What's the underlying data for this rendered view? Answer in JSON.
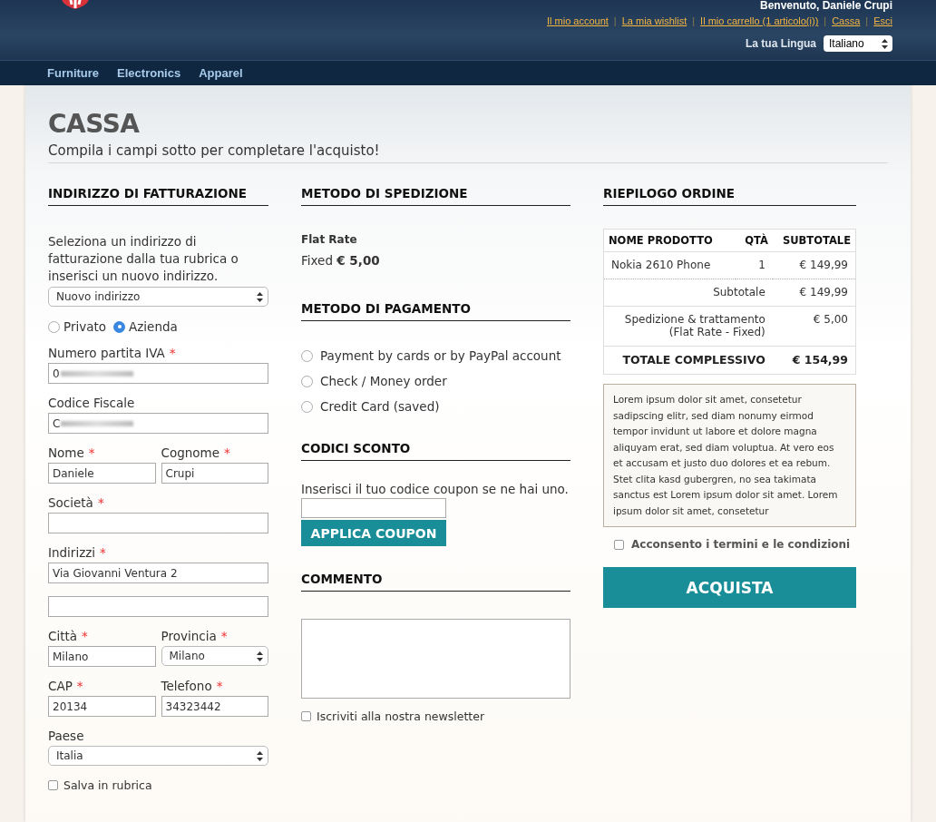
{
  "header": {
    "welcome": "Benvenuto, Daniele Crupi",
    "links": [
      "Il mio account",
      "La mia wishlist",
      "Il mio carrello (1 articolo(i))",
      "Cassa",
      "Esci"
    ],
    "separator": "|",
    "language_label": "La tua Lingua",
    "language": "Italiano"
  },
  "nav": {
    "items": [
      "Furniture",
      "Electronics",
      "Apparel"
    ]
  },
  "page": {
    "title": "CASSA",
    "subtitle": "Compila i campi sotto per completare l'acquisto!"
  },
  "billing": {
    "heading": "INDIRIZZO DI FATTURAZIONE",
    "intro": "Seleziona un indirizzo di fatturazione dalla tua rubrica o inserisci un nuovo indirizzo.",
    "address_select": "Nuovo indirizzo",
    "customer_types": [
      {
        "label": "Privato",
        "selected": false
      },
      {
        "label": "Azienda",
        "selected": true
      }
    ],
    "rows": [
      [
        {
          "kind": "blurred",
          "label": "Numero partita IVA",
          "marker": "*",
          "value": "0"
        }
      ],
      [
        {
          "kind": "blurred",
          "label": "Codice Fiscale",
          "value": "C"
        }
      ],
      [
        {
          "kind": "text",
          "label": "Nome",
          "marker": "*",
          "value": "Daniele"
        },
        {
          "kind": "text",
          "label": "Cognome",
          "marker": "*",
          "value": "Crupi"
        }
      ],
      [
        {
          "kind": "text",
          "label": "Società",
          "marker": "*"
        }
      ],
      [
        {
          "kind": "text",
          "label": "Indirizzi",
          "marker": "*",
          "value": "Via Giovanni Ventura 2"
        }
      ],
      [
        {
          "kind": "text"
        }
      ],
      [
        {
          "kind": "text",
          "label": "Città",
          "marker": "*",
          "value": "Milano"
        },
        {
          "kind": "select",
          "label": "Provincia",
          "marker": "*",
          "value": "Milano"
        }
      ],
      [
        {
          "kind": "text",
          "label": "CAP",
          "marker": "*",
          "value": "20134"
        },
        {
          "kind": "text",
          "label": "Telefono",
          "marker": "*",
          "value": "34323442"
        }
      ],
      [
        {
          "kind": "select",
          "label": "Paese",
          "value": "Italia"
        }
      ]
    ],
    "save": {
      "label": "Salva in rubrica",
      "checked": false
    }
  },
  "shipping": {
    "heading": "METODO DI SPEDIZIONE",
    "method": "Flat Rate",
    "price": "Fixed **€ 5,00**"
  },
  "payment": {
    "heading": "METODO DI PAGAMENTO",
    "options": [
      {
        "label": "Payment by cards or by PayPal account",
        "selected": false
      },
      {
        "label": "Check / Money order",
        "selected": false
      },
      {
        "label": "Credit Card (saved)",
        "selected": false
      }
    ]
  },
  "discount": {
    "heading": "CODICI SCONTO",
    "prompt": "Inserisci il tuo codice coupon se ne hai uno.",
    "button": "APPLICA COUPON"
  },
  "comment": {
    "heading": "COMMENTO",
    "newsletter": {
      "label": "Iscriviti alla nostra newsletter",
      "checked": false
    }
  },
  "summary": {
    "heading": "RIEPILOGO ORDINE",
    "columns": [
      "NOME PRODOTTO",
      "QTÀ",
      "SUBTOTALE"
    ],
    "items": [
      {
        "name": "Nokia 2610 Phone",
        "qty": "1",
        "subtotal": "€ 149,99"
      }
    ],
    "totals": [
      {
        "kind": "normal",
        "label": "Subtotale",
        "value": "€ 149,99"
      },
      {
        "kind": "normal",
        "label": "Spedizione & trattamento",
        "note": "(Flat Rate - Fixed)",
        "value": "€ 5,00"
      },
      {
        "kind": "grand",
        "label": "TOTALE COMPLESSIVO",
        "value": "€ 154,99"
      }
    ],
    "terms": "Lorem ipsum dolor sit amet, consetetur sadipscing elitr, sed diam nonumy eirmod tempor invidunt ut labore et dolore magna aliquyam erat, sed diam voluptua. At vero eos et accusam et justo duo dolores et ea rebum. Stet clita kasd gubergren, no sea takimata sanctus est Lorem ipsum dolor sit amet. Lorem ipsum dolor sit amet, consetetur",
    "consent": {
      "label": "Acconsento i termini e le condizioni",
      "checked": false
    },
    "buy": "ACQUISTA"
  }
}
